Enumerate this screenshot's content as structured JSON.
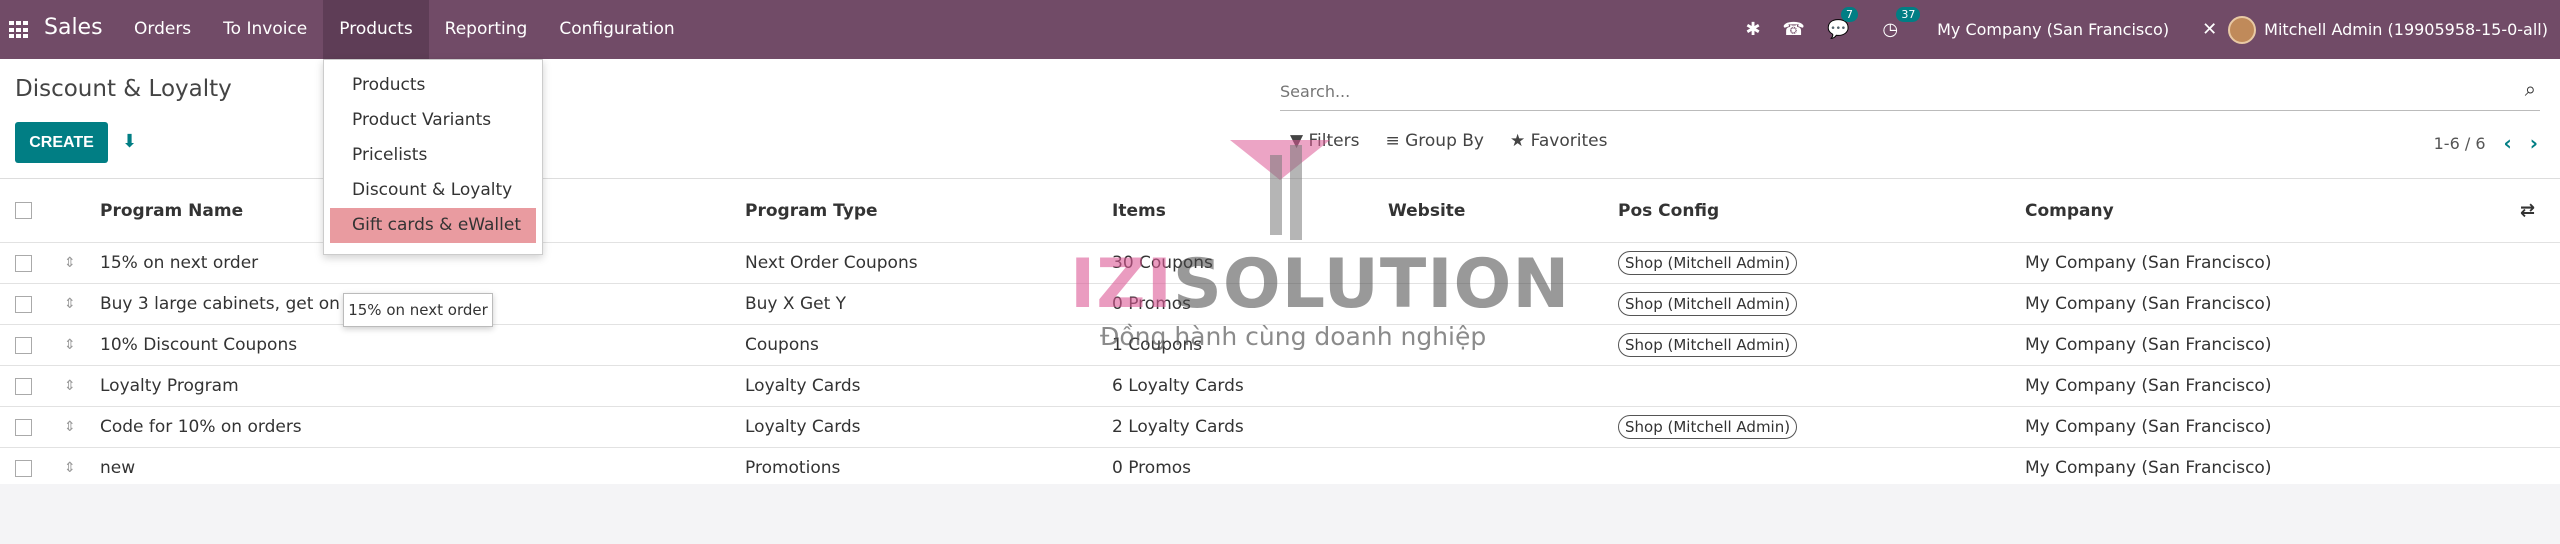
{
  "navbar": {
    "brand": "Sales",
    "menu": [
      {
        "label": "Orders"
      },
      {
        "label": "To Invoice"
      },
      {
        "label": "Products"
      },
      {
        "label": "Reporting"
      },
      {
        "label": "Configuration"
      }
    ],
    "messages_count": "7",
    "activities_count": "37",
    "company": "My Company (San Francisco)",
    "user": "Mitchell Admin (19905958-15-0-all)"
  },
  "control": {
    "title": "Discount & Loyalty",
    "create_label": "CREATE",
    "search_placeholder": "Search...",
    "filters_label": "Filters",
    "groupby_label": "Group By",
    "favorites_label": "Favorites",
    "pager": "1-6 / 6"
  },
  "table": {
    "headers": {
      "name": "Program Name",
      "type": "Program Type",
      "items": "Items",
      "website": "Website",
      "pos": "Pos Config",
      "company": "Company"
    },
    "rows": [
      {
        "name": "15% on next order",
        "type": "Next Order Coupons",
        "items": "30 Coupons",
        "pos": "Shop (Mitchell Admin)",
        "company": "My Company (San Francisco)"
      },
      {
        "name": "Buy 3 large cabinets, get one for free",
        "type": "Buy X Get Y",
        "items": "0 Promos",
        "pos": "Shop (Mitchell Admin)",
        "company": "My Company (San Francisco)"
      },
      {
        "name": "10% Discount Coupons",
        "type": "Coupons",
        "items": "1 Coupons",
        "pos": "Shop (Mitchell Admin)",
        "company": "My Company (San Francisco)"
      },
      {
        "name": "Loyalty Program",
        "type": "Loyalty Cards",
        "items": "6 Loyalty Cards",
        "pos": "",
        "company": "My Company (San Francisco)"
      },
      {
        "name": "Code for 10% on orders",
        "type": "Loyalty Cards",
        "items": "2 Loyalty Cards",
        "pos": "Shop (Mitchell Admin)",
        "company": "My Company (San Francisco)"
      },
      {
        "name": "new",
        "type": "Promotions",
        "items": "0 Promos",
        "pos": "",
        "company": "My Company (San Francisco)"
      }
    ]
  },
  "dropdown": {
    "items": [
      {
        "label": "Products"
      },
      {
        "label": "Product Variants"
      },
      {
        "label": "Pricelists"
      },
      {
        "label": "Discount & Loyalty"
      },
      {
        "label": "Gift cards & eWallet"
      }
    ]
  },
  "tooltip": "15% on next order",
  "watermark": {
    "brand_a": "IZI",
    "brand_b": "SOLUTION",
    "tagline": "Đồng hành cùng doanh nghiệp"
  },
  "colors": {
    "navbar": "#714b67",
    "primary": "#017e84",
    "highlight": "#e99ba0"
  }
}
